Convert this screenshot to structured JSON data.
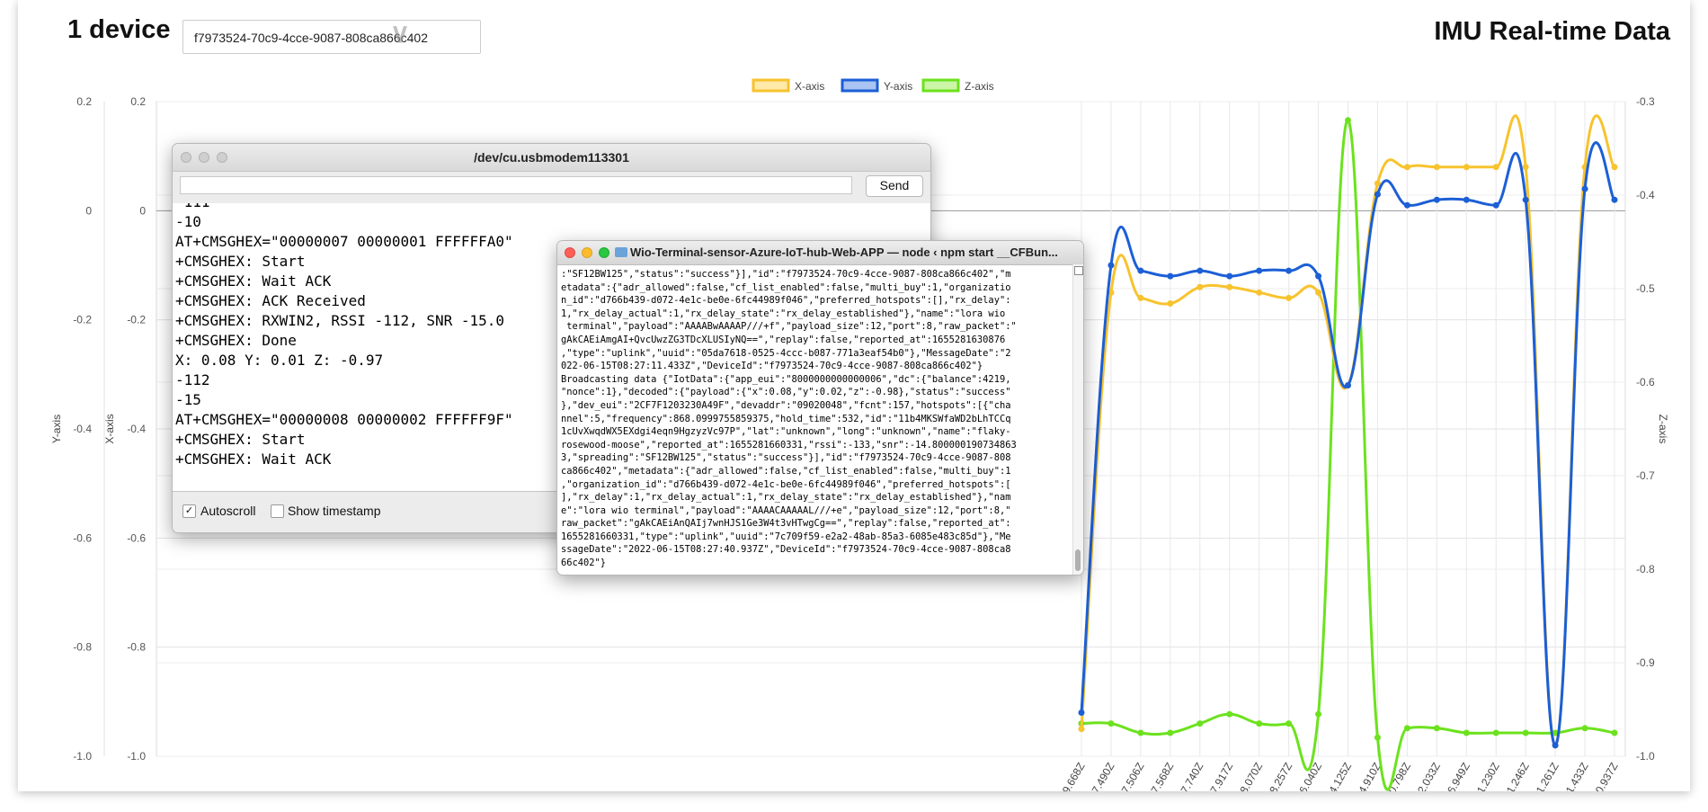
{
  "header": {
    "device_count": "1 device",
    "device_id": "f7973524-70c9-4cce-9087-808ca866c402",
    "title": "IMU Real-time Data"
  },
  "chart_data": {
    "type": "line",
    "legend_position": "top",
    "xlabel": "",
    "x_tick_labels": [
      "19.668Z",
      "07.490Z",
      "07.506Z",
      "07.568Z",
      "07.740Z",
      "07.917Z",
      "08.070Z",
      "08.257Z",
      "16.040Z",
      "54.125Z",
      "04.910Z",
      "40.798Z",
      "42.033Z",
      "06.949Z",
      "11.230Z",
      "11.246Z",
      "11.261Z",
      "11.433Z",
      "40.937Z"
    ],
    "series": [
      {
        "name": "X-axis",
        "axis": "x",
        "color": "#f7c32e",
        "fill": "#fde9a8",
        "values": [
          -0.95,
          -0.15,
          -0.16,
          -0.17,
          -0.14,
          -0.14,
          -0.15,
          -0.16,
          -0.15,
          -0.32,
          0.05,
          0.08,
          0.08,
          0.08,
          0.08,
          0.08,
          -0.98,
          0.08,
          0.08
        ]
      },
      {
        "name": "Y-axis",
        "axis": "y",
        "color": "#1c5fd6",
        "fill": "#a9c4f2",
        "values": [
          -0.92,
          -0.1,
          -0.11,
          -0.12,
          -0.11,
          -0.12,
          -0.11,
          -0.11,
          -0.12,
          -0.32,
          0.03,
          0.01,
          0.02,
          0.02,
          0.01,
          0.02,
          -0.98,
          0.04,
          0.02
        ]
      },
      {
        "name": "Z-axis",
        "axis": "z",
        "color": "#6ce21e",
        "fill": "#cdf5a8",
        "values": [
          -0.965,
          -0.965,
          -0.975,
          -0.975,
          -0.965,
          -0.955,
          -0.965,
          -0.965,
          -0.955,
          -0.32,
          -0.98,
          -0.97,
          -0.97,
          -0.975,
          -0.975,
          -0.975,
          -0.975,
          -0.97,
          -0.975
        ]
      }
    ],
    "axes": {
      "x": {
        "label": "X-axis",
        "ylim": [
          -1.0,
          0.2
        ],
        "ticks": [
          "0.2",
          "0",
          "-0.2",
          "-0.4",
          "-0.6",
          "-0.8",
          "-1.0"
        ]
      },
      "y": {
        "label": "Y-axis",
        "ylim": [
          -1.0,
          0.2
        ],
        "ticks": [
          "0.2",
          "0",
          "-0.2",
          "-0.4",
          "-0.6",
          "-0.8",
          "-1.0"
        ]
      },
      "z": {
        "label": "Z-axis",
        "ylim": [
          -1.0,
          -0.3
        ],
        "ticks": [
          "-0.3",
          "-0.4",
          "-0.5",
          "-0.6",
          "-0.7",
          "-0.8",
          "-0.9",
          "-1.0"
        ]
      }
    },
    "grid": true
  },
  "serial_window": {
    "title": "/dev/cu.usbmodem113301",
    "input_value": "",
    "send_label": "Send",
    "lines": [
      "-111",
      "-10",
      "AT+CMSGHEX=\"00000007 00000001 FFFFFFA0\"",
      "+CMSGHEX: Start",
      "+CMSGHEX: Wait ACK",
      "+CMSGHEX: ACK Received",
      "+CMSGHEX: RXWIN2, RSSI -112, SNR -15.0",
      "+CMSGHEX: Done",
      "X: 0.08 Y: 0.01 Z: -0.97",
      "-112",
      "-15",
      "AT+CMSGHEX=\"00000008 00000002 FFFFFF9F\"",
      "+CMSGHEX: Start",
      "+CMSGHEX: Wait ACK"
    ],
    "autoscroll_label": "Autoscroll",
    "autoscroll_checked": true,
    "timestamp_label": "Show timestamp",
    "timestamp_checked": false
  },
  "terminal_window": {
    "title": "Wio-Terminal-sensor-Azure-IoT-hub-Web-APP — node ‹ npm start __CFBun...",
    "lines": [
      ":\"SF12BW125\",\"status\":\"success\"}],\"id\":\"f7973524-70c9-4cce-9087-808ca866c402\",\"m",
      "etadata\":{\"adr_allowed\":false,\"cf_list_enabled\":false,\"multi_buy\":1,\"organizatio",
      "n_id\":\"d766b439-d072-4e1c-be0e-6fc44989f046\",\"preferred_hotspots\":[],\"rx_delay\":",
      "1,\"rx_delay_actual\":1,\"rx_delay_state\":\"rx_delay_established\"},\"name\":\"lora wio",
      " terminal\",\"payload\":\"AAAABwAAAAP///+f\",\"payload_size\":12,\"port\":8,\"raw_packet\":\"",
      "gAkCAEiAmgAI+QvcUwzZG3TDcXLUSIyNQ==\",\"replay\":false,\"reported_at\":1655281630876",
      ",\"type\":\"uplink\",\"uuid\":\"05da7618-0525-4ccc-b087-771a3eaf54b0\"},\"MessageDate\":\"2",
      "022-06-15T08:27:11.433Z\",\"DeviceId\":\"f7973524-70c9-4cce-9087-808ca866c402\"}",
      "Broadcasting data {\"IotData\":{\"app_eui\":\"8000000000000006\",\"dc\":{\"balance\":4219,",
      "\"nonce\":1},\"decoded\":{\"payload\":{\"x\":0.08,\"y\":0.02,\"z\":-0.98},\"status\":\"success\"",
      "},\"dev_eui\":\"2CF7F1203230A49F\",\"devaddr\":\"09020048\",\"fcnt\":157,\"hotspots\":[{\"cha",
      "nnel\":5,\"frequency\":868.0999755859375,\"hold_time\":532,\"id\":\"11b4MKSWfaWD2bLhTCCq",
      "1cUvXwqdWX5EXdgi4eqn9HgzyzVc97P\",\"lat\":\"unknown\",\"long\":\"unknown\",\"name\":\"flaky-",
      "rosewood-moose\",\"reported_at\":1655281660331,\"rssi\":-133,\"snr\":-14.800000190734863",
      "3,\"spreading\":\"SF12BW125\",\"status\":\"success\"}],\"id\":\"f7973524-70c9-4cce-9087-808",
      "ca866c402\",\"metadata\":{\"adr_allowed\":false,\"cf_list_enabled\":false,\"multi_buy\":1",
      ",\"organization_id\":\"d766b439-d072-4e1c-be0e-6fc44989f046\",\"preferred_hotspots\":[",
      "],\"rx_delay\":1,\"rx_delay_actual\":1,\"rx_delay_state\":\"rx_delay_established\"},\"nam",
      "e\":\"lora wio terminal\",\"payload\":\"AAAACAAAAAL///+e\",\"payload_size\":12,\"port\":8,\"",
      "raw_packet\":\"gAkCAEiAnQAIj7wnHJS1Ge3W4t3vHTwgCg==\",\"replay\":false,\"reported_at\":",
      "1655281660331,\"type\":\"uplink\",\"uuid\":\"7c709f59-e2a2-48ab-85a3-6085e483c85d\"},\"Me",
      "ssageDate\":\"2022-06-15T08:27:40.937Z\",\"DeviceId\":\"f7973524-70c9-4cce-9087-808ca8",
      "66c402\"}"
    ]
  }
}
